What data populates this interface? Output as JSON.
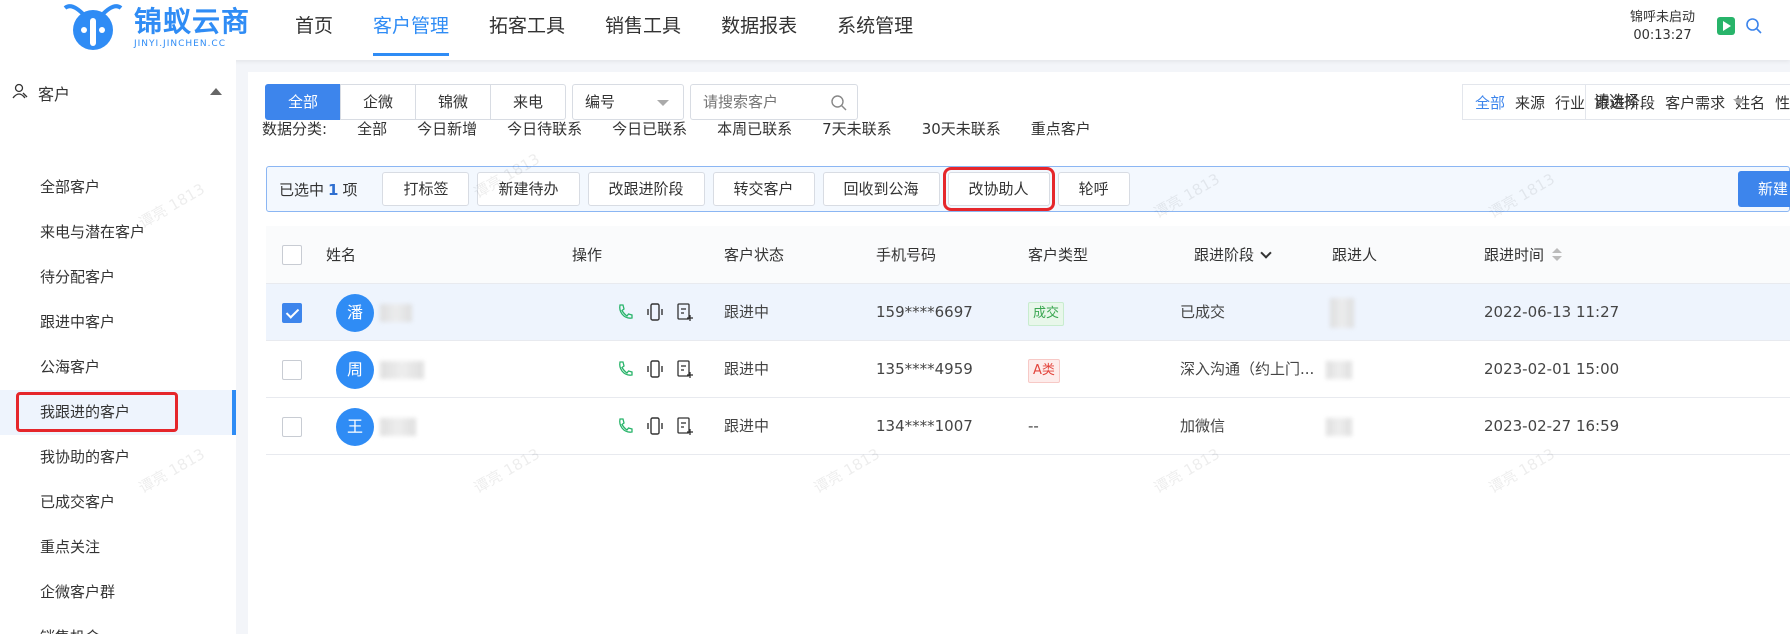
{
  "logo": {
    "name": "锦蚁云商",
    "subtitle": "JINYI.JINCHEN.CC"
  },
  "nav": [
    {
      "label": "首页"
    },
    {
      "label": "客户管理"
    },
    {
      "label": "拓客工具"
    },
    {
      "label": "销售工具"
    },
    {
      "label": "数据报表"
    },
    {
      "label": "系统管理"
    }
  ],
  "nav_active": "客户管理",
  "call": {
    "status": "锦呼未启动",
    "timer": "00:13:27"
  },
  "sidebar": {
    "header": "客户",
    "items": [
      {
        "label": "全部客户"
      },
      {
        "label": "来电与潜在客户"
      },
      {
        "label": "待分配客户"
      },
      {
        "label": "跟进中客户"
      },
      {
        "label": "公海客户"
      },
      {
        "label": "我跟进的客户"
      },
      {
        "label": "我协助的客户"
      },
      {
        "label": "已成交客户"
      },
      {
        "label": "重点关注"
      },
      {
        "label": "企微客户群"
      },
      {
        "label": "销售机会"
      }
    ],
    "active": "我跟进的客户"
  },
  "segments": [
    "全部",
    "企微",
    "锦微",
    "来电"
  ],
  "search": {
    "field": "编号",
    "placeholder": "请搜索客户"
  },
  "filters": {
    "items": [
      "全部",
      "来源",
      "行业",
      "跟进阶段",
      "客户需求",
      "姓名",
      "性别"
    ],
    "select_placeholder": "请选择"
  },
  "categories": {
    "label": "数据分类:",
    "items": [
      "全部",
      "今日新增",
      "今日待联系",
      "今日已联系",
      "本周已联系",
      "7天未联系",
      "30天未联系",
      "重点客户"
    ]
  },
  "selection": {
    "prefix": "已选中",
    "count": "1",
    "suffix": "项"
  },
  "actions": [
    "打标签",
    "新建待办",
    "改跟进阶段",
    "转交客户",
    "回收到公海",
    "改协助人",
    "轮呼"
  ],
  "highlighted_action": "改协助人",
  "new_button": "新建",
  "table": {
    "headers": [
      "姓名",
      "操作",
      "客户状态",
      "手机号码",
      "客户类型",
      "跟进阶段",
      "跟进人",
      "跟进时间"
    ],
    "rows": [
      {
        "avatar": "潘",
        "checked": true,
        "status": "跟进中",
        "phone": "159****6697",
        "type": "成交",
        "type_style": "green",
        "stage": "已成交",
        "time": "2022-06-13 11:27"
      },
      {
        "avatar": "周",
        "checked": false,
        "status": "跟进中",
        "phone": "135****4959",
        "type": "A类",
        "type_style": "red",
        "stage": "深入沟通（约上门...",
        "time": "2023-02-01 15:00"
      },
      {
        "avatar": "王",
        "checked": false,
        "status": "跟进中",
        "phone": "134****1007",
        "type": "--",
        "type_style": "none",
        "stage": "加微信",
        "time": "2023-02-27 16:59"
      }
    ]
  },
  "watermark": "谭亮 1813",
  "colors": {
    "accent": "#3d85ec",
    "highlight": "#e5262b",
    "call_green": "#28b46a"
  }
}
